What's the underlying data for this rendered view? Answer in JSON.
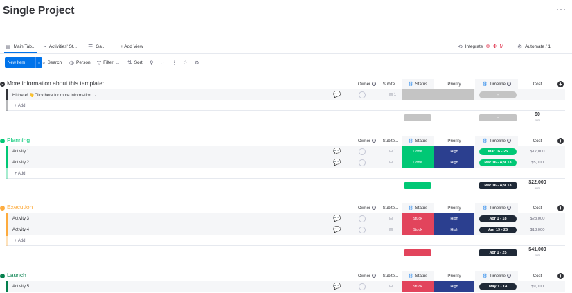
{
  "project": {
    "title": "Single Project",
    "more_label": "···"
  },
  "views": {
    "tabs": [
      {
        "label": "Main Tab...",
        "icon": "table-icon"
      },
      {
        "label": "Activities' St...",
        "icon": "chart-icon"
      },
      {
        "label": "Ga...",
        "icon": "gantt-icon"
      }
    ],
    "add_view": "+ Add View",
    "integrate": "Integrate",
    "automate": "Automate / 1"
  },
  "toolbar": {
    "new_item": "New Item",
    "search": "Search",
    "person": "Person",
    "filter": "Filter",
    "sort": "Sort"
  },
  "columns": {
    "owner": "Owner",
    "subitems": "Subite...",
    "status": "Status",
    "priority": "Priority",
    "timeline": "Timeline",
    "cost": "Cost"
  },
  "add_label": "+ Add",
  "sum_label": "sum",
  "colors": {
    "accent": "#0073ea",
    "done": "#00c875",
    "stuck": "#e2445c",
    "high": "#401694",
    "high_display": "#2b3f8f",
    "timeline_dark": "#1f2937"
  },
  "groups": [
    {
      "title": "More information about this template:",
      "color": "#323338",
      "rows": [
        {
          "name": "Hi there! 👋Click here for more information →",
          "subitems": "1",
          "status": "",
          "priority": "",
          "timeline": "-",
          "cost": ""
        }
      ],
      "summary": {
        "timeline": "-",
        "cost": "$0"
      }
    },
    {
      "title": "Planning",
      "color": "#00c875",
      "rows": [
        {
          "name": "Activity 1",
          "subitems": "1",
          "status": "Done",
          "priority": "High",
          "timeline": "Mar 16 - 25",
          "cost": "$17,000"
        },
        {
          "name": "Activity 2",
          "subitems": "",
          "status": "Done",
          "priority": "High",
          "timeline": "Mar 16 - Apr 13",
          "cost": "$5,000"
        }
      ],
      "summary": {
        "timeline": "Mar 16 - Apr 13",
        "cost": "$22,000"
      }
    },
    {
      "title": "Execution",
      "color": "#fdab3d",
      "rows": [
        {
          "name": "Activity 3",
          "subitems": "",
          "status": "Stuck",
          "priority": "High",
          "timeline": "Apr 1 - 18",
          "cost": "$23,000"
        },
        {
          "name": "Activity 4",
          "subitems": "",
          "status": "Stuck",
          "priority": "High",
          "timeline": "Apr 19 - 25",
          "cost": "$18,000"
        }
      ],
      "summary": {
        "timeline": "Apr 1 - 25",
        "cost": "$41,000"
      }
    },
    {
      "title": "Launch",
      "color": "#037f4c",
      "rows": [
        {
          "name": "Activity 5",
          "subitems": "",
          "status": "Stuck",
          "priority": "High",
          "timeline": "May 1 - 14",
          "cost": "$9,000"
        }
      ]
    }
  ]
}
